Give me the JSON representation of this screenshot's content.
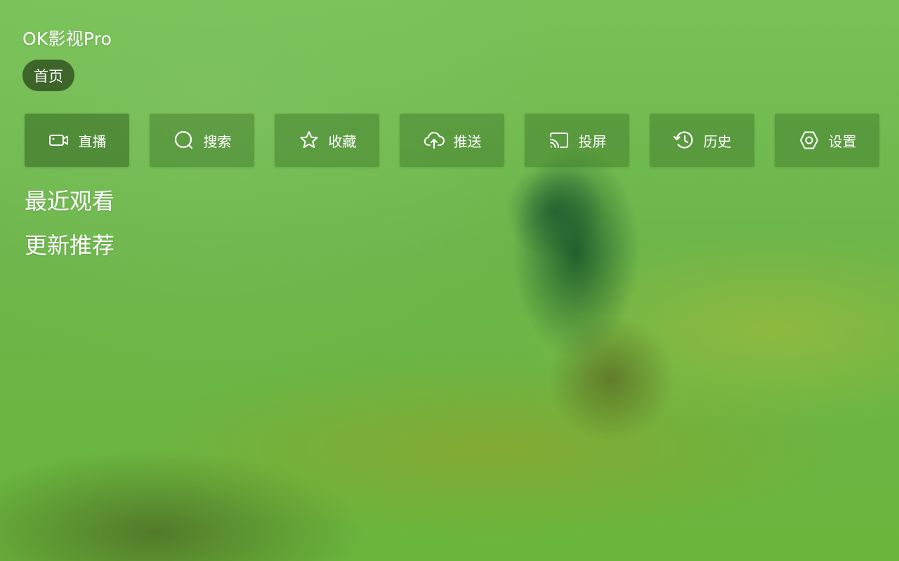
{
  "app": {
    "title": "OK影视Pro"
  },
  "nav": {
    "tabs": [
      {
        "label": "首页",
        "active": true
      }
    ]
  },
  "toolbar": {
    "items": [
      {
        "label": "直播",
        "icon": "live-camera-icon"
      },
      {
        "label": "搜索",
        "icon": "search-icon"
      },
      {
        "label": "收藏",
        "icon": "star-icon"
      },
      {
        "label": "推送",
        "icon": "cloud-upload-icon"
      },
      {
        "label": "投屏",
        "icon": "cast-icon"
      },
      {
        "label": "历史",
        "icon": "history-icon"
      },
      {
        "label": "设置",
        "icon": "settings-icon"
      }
    ]
  },
  "sections": {
    "recent": {
      "title": "最近观看"
    },
    "recommend": {
      "title": "更新推荐"
    }
  },
  "colors": {
    "background_green": "#6cb54a",
    "home_tab_bg": "#2d4b1e",
    "tool_bg": "#376e23",
    "text": "#ffffff"
  }
}
